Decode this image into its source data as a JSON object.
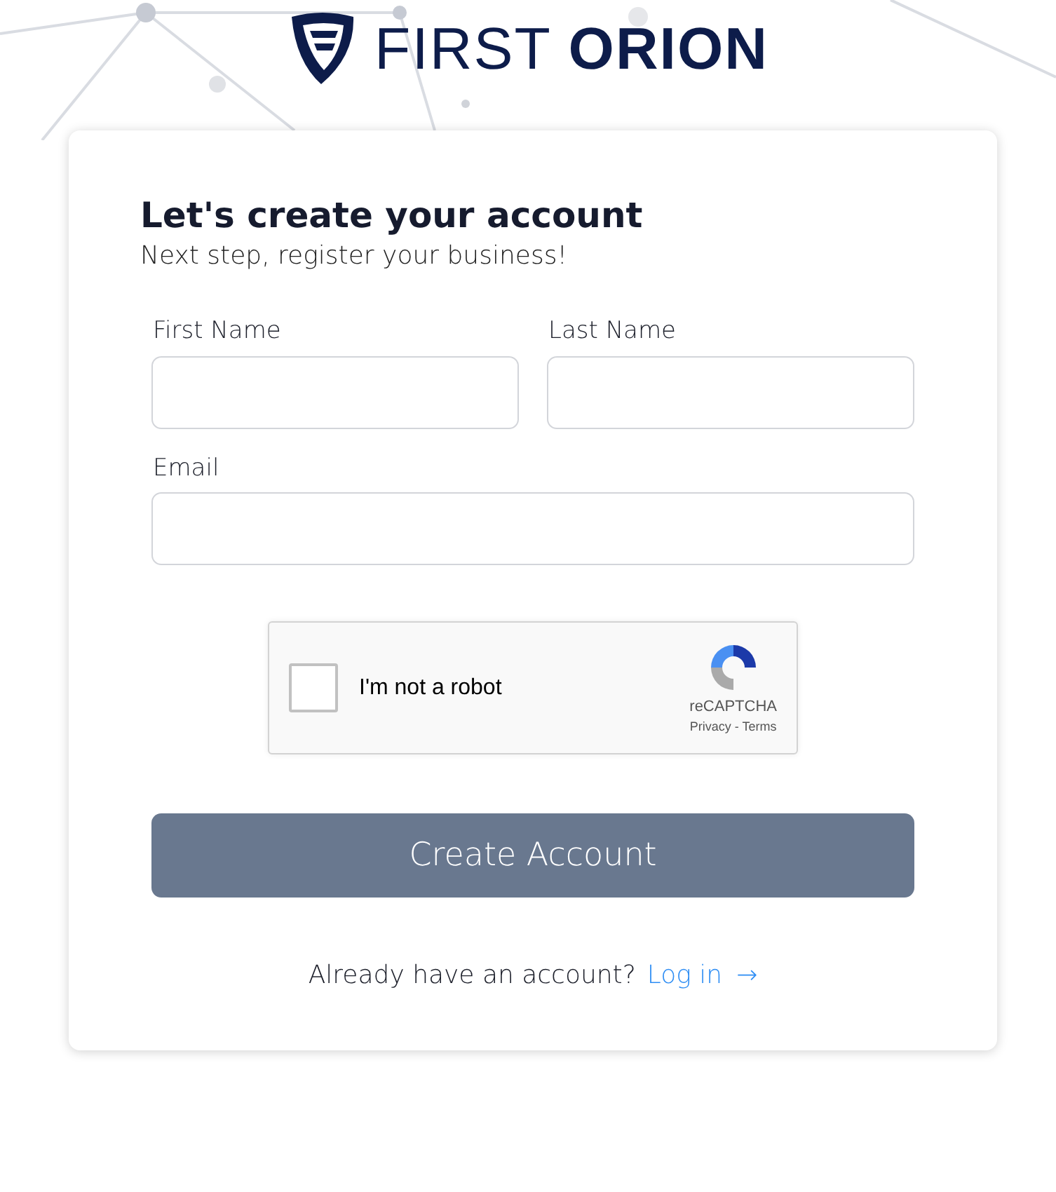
{
  "logo": {
    "text": "FIRST **ORION**"
  },
  "heading": "Let's create your account",
  "subheading": "Next step, register your business!",
  "fields": [
    {
      "label": "First Name",
      "half": true
    },
    {
      "label": "Last Name",
      "half": true
    },
    {
      "label": "Email",
      "half": false
    }
  ],
  "captcha": {
    "label": "I'm not a robot",
    "checked": false,
    "brand": "reCAPTCHA",
    "privacy": "Privacy",
    "separator": "-",
    "terms": "Terms"
  },
  "submit": "Create Account",
  "footer": {
    "prompt": "Already have an account?",
    "link": "Log in",
    "arrow": "→"
  }
}
